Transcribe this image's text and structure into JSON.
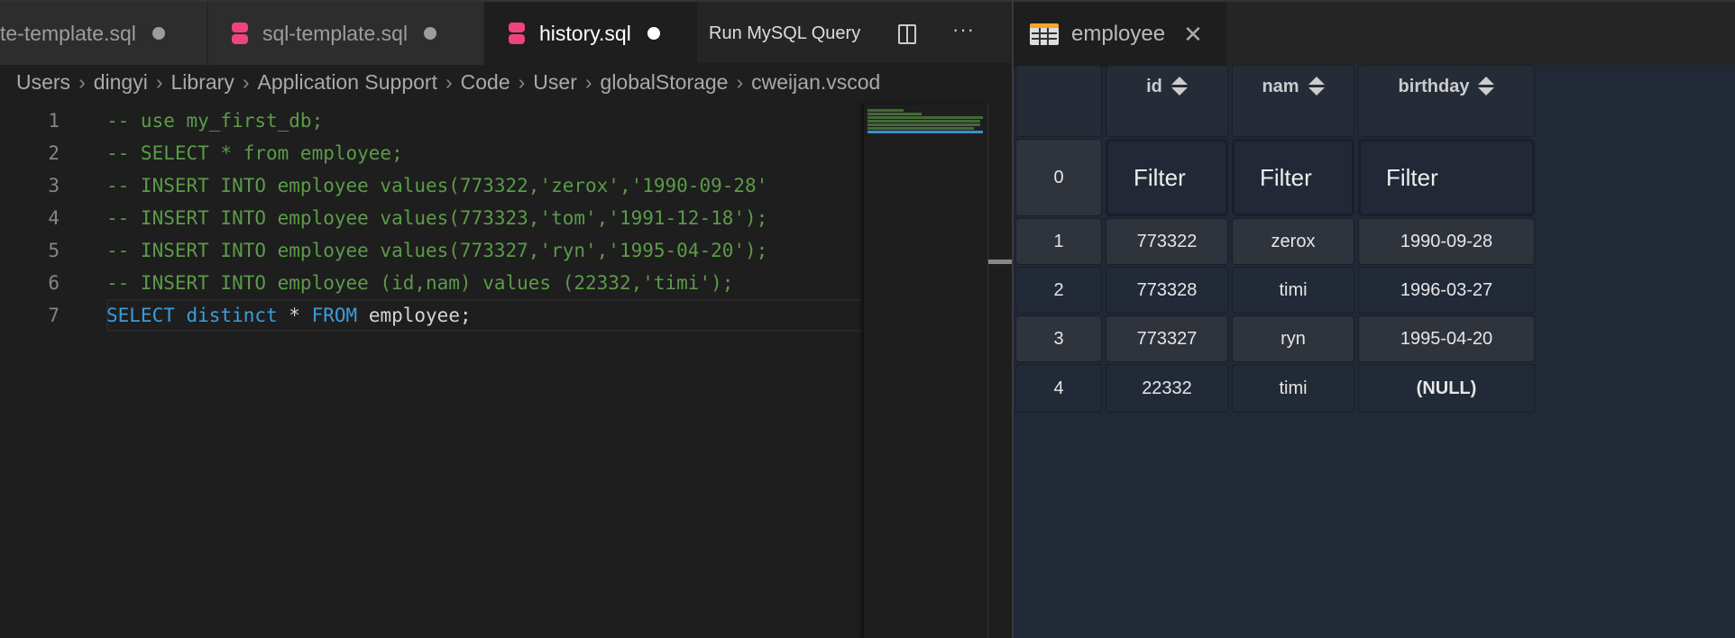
{
  "editor": {
    "tabs": [
      {
        "label": "te-template.sql",
        "modified": true,
        "active": false
      },
      {
        "label": "sql-template.sql",
        "modified": true,
        "active": false
      },
      {
        "label": "history.sql",
        "modified": true,
        "active": true
      }
    ],
    "run_query_label": "Run MySQL Query",
    "more_label": "···",
    "breadcrumb": [
      "Users",
      "dingyi",
      "Library",
      "Application Support",
      "Code",
      "User",
      "globalStorage",
      "cweijan.vscod"
    ],
    "lines": [
      {
        "n": "1",
        "text": "-- use my_first_db;"
      },
      {
        "n": "2",
        "text": "-- SELECT * from employee;"
      },
      {
        "n": "3",
        "text": "-- INSERT INTO employee values(773322,'zerox','1990-09-28'"
      },
      {
        "n": "4",
        "text": "-- INSERT INTO employee values(773323,'tom','1991-12-18');"
      },
      {
        "n": "5",
        "text": "-- INSERT INTO employee values(773327,'ryn','1995-04-20');"
      },
      {
        "n": "6",
        "text": "-- INSERT INTO employee (id,nam) values (22332,'timi');"
      },
      {
        "n": "7",
        "kw1": "SELECT distinct",
        "op": " * ",
        "kw2": "FROM",
        "rest": " employee;"
      }
    ]
  },
  "results": {
    "tab_label": "employee",
    "columns": [
      "id",
      "nam",
      "birthday"
    ],
    "filter_placeholder": "Filter",
    "filter_row_index": "0",
    "rows": [
      {
        "n": "1",
        "id": "773322",
        "nam": "zerox",
        "birthday": "1990-09-28"
      },
      {
        "n": "2",
        "id": "773328",
        "nam": "timi",
        "birthday": "1996-03-27"
      },
      {
        "n": "3",
        "id": "773327",
        "nam": "ryn",
        "birthday": "1995-04-20"
      },
      {
        "n": "4",
        "id": "22332",
        "nam": "timi",
        "birthday": "(NULL)"
      }
    ]
  },
  "colors": {
    "db_icon": "#f0437a",
    "comment": "#5b9b48",
    "keyword": "#3c9ddb",
    "table_icon_top": "#f5a623"
  }
}
